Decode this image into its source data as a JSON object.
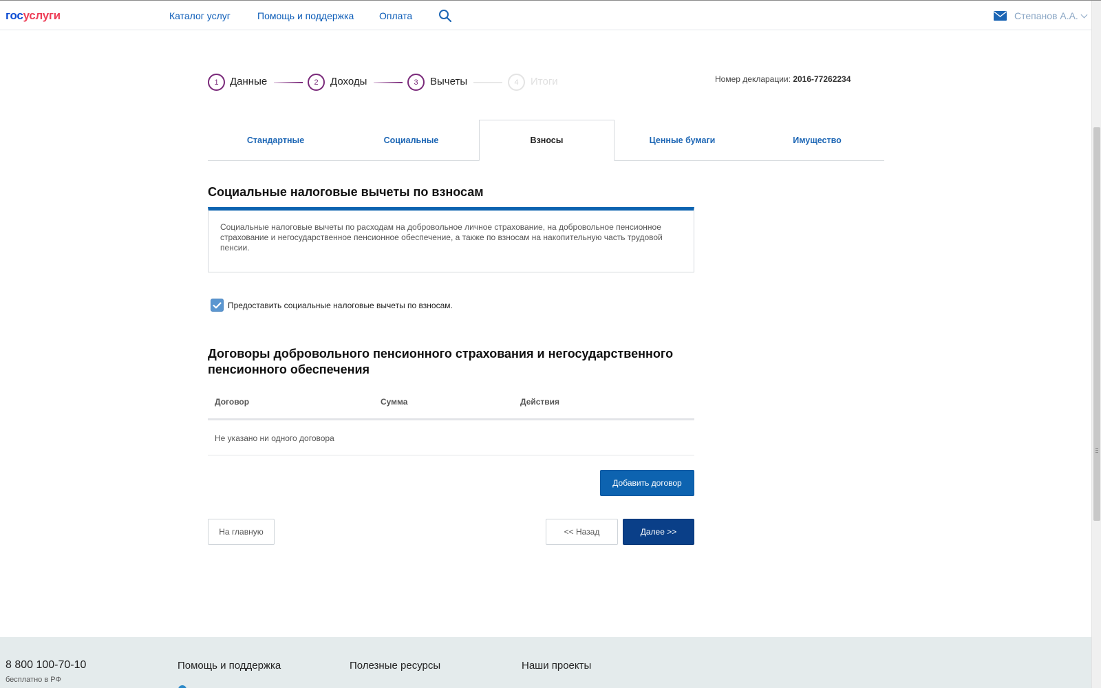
{
  "header": {
    "logo_part1": "гос",
    "logo_part2": "услуги",
    "nav": [
      "Каталог услуг",
      "Помощь и поддержка",
      "Оплата"
    ],
    "user": "Степанов А.А."
  },
  "steps": [
    {
      "num": "1",
      "label": "Данные",
      "state": "done"
    },
    {
      "num": "2",
      "label": "Доходы",
      "state": "done"
    },
    {
      "num": "3",
      "label": "Вычеты",
      "state": "current"
    },
    {
      "num": "4",
      "label": "Итоги",
      "state": "inactive"
    }
  ],
  "declaration": {
    "label": "Номер декларации:",
    "value": "2016-77262234"
  },
  "tabs": [
    "Стандартные",
    "Социальные",
    "Взносы",
    "Ценные бумаги",
    "Имущество"
  ],
  "active_tab": "Взносы",
  "section": {
    "title": "Социальные налоговые вычеты по взносам",
    "info": "Социальные налоговые вычеты по расходам на добровольное личное страхование, на добровольное пенсионное страхование и негосударственное пенсионное обеспечение, а также по взносам на накопительную часть трудовой пенсии.",
    "checkbox_label": "Предоставить социальные налоговые вычеты по взносам.",
    "checkbox_checked": true
  },
  "contracts": {
    "title": "Договоры добровольного пенсионного страхования и негосударственного пенсионного обеспечения",
    "columns": [
      "Договор",
      "Сумма",
      "Действия"
    ],
    "empty_text": "Не указано ни одного договора",
    "add_button": "Добавить договор"
  },
  "nav_buttons": {
    "home": "На главную",
    "back": "<< Назад",
    "next": "Далее >>"
  },
  "footer": {
    "phone": "8 800 100-70-10",
    "free": "бесплатно в РФ",
    "columns": [
      "Помощь и поддержка",
      "Полезные ресурсы",
      "Наши проекты"
    ]
  },
  "colors": {
    "accent": "#0d63b0",
    "step": "#7a2a7a",
    "link": "#1b65b4",
    "footer_bg": "#e4ebec"
  }
}
